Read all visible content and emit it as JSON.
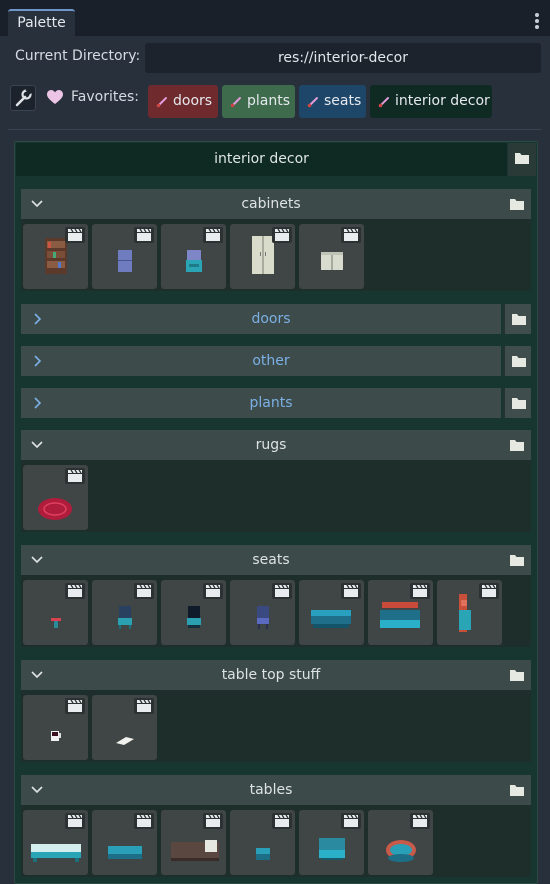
{
  "tab": {
    "label": "Palette"
  },
  "directory": {
    "label": "Current Directory:",
    "value": "res://interior-decor"
  },
  "favorites": {
    "label": "Favorites:",
    "chips": [
      {
        "label": "doors",
        "color": "#6e2a2c"
      },
      {
        "label": "plants",
        "color": "#3e6b4c"
      },
      {
        "label": "seats",
        "color": "#1e4668"
      },
      {
        "label": "interior decor",
        "color": "#0f2a23"
      }
    ]
  },
  "tree": {
    "root_title": "interior decor",
    "sections": [
      {
        "title": "cabinets",
        "expanded": true,
        "items": [
          "bookshelf",
          "small cabinet",
          "drawer cabinet",
          "wardrobe",
          "side cabinet"
        ]
      },
      {
        "title": "doors",
        "expanded": false
      },
      {
        "title": "other",
        "expanded": false
      },
      {
        "title": "plants",
        "expanded": false
      },
      {
        "title": "rugs",
        "expanded": true,
        "items": [
          "round red rug"
        ]
      },
      {
        "title": "seats",
        "expanded": true,
        "items": [
          "red stool",
          "chair teal",
          "chair dark",
          "chair blue",
          "teal sofa",
          "red sofa",
          "corner sofa"
        ]
      },
      {
        "title": "table top stuff",
        "expanded": true,
        "items": [
          "mug",
          "paper"
        ]
      },
      {
        "title": "tables",
        "expanded": true,
        "items": [
          "long table",
          "coffee table",
          "bed",
          "small table",
          "desk",
          "round table"
        ]
      }
    ]
  },
  "colors": {
    "accent": "#6f96c8",
    "collapsed_title": "#7cb0e4"
  }
}
